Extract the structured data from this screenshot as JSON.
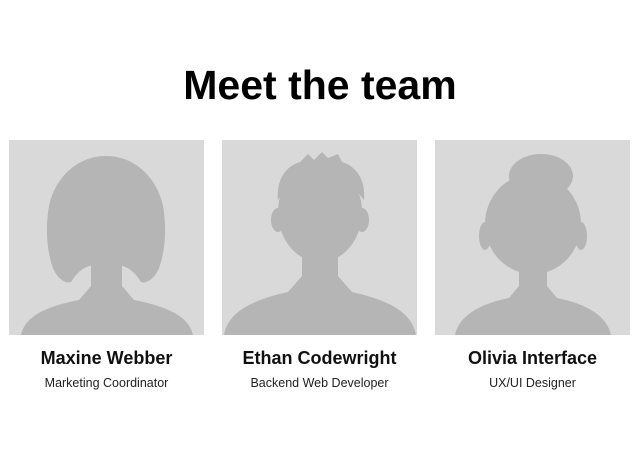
{
  "page": {
    "title": "Meet the team"
  },
  "team": {
    "members": [
      {
        "name": "Maxine Webber",
        "role": "Marketing Coordinator",
        "avatar_icon": "person-silhouette-bob-hair-icon"
      },
      {
        "name": "Ethan Codewright",
        "role": "Backend Web Developer",
        "avatar_icon": "person-silhouette-short-hair-icon"
      },
      {
        "name": "Olivia Interface",
        "role": "UX/UI Designer",
        "avatar_icon": "person-silhouette-bun-hair-icon"
      }
    ]
  },
  "colors": {
    "avatar_background": "#d9d9d9",
    "silhouette": "#b5b5b5"
  }
}
